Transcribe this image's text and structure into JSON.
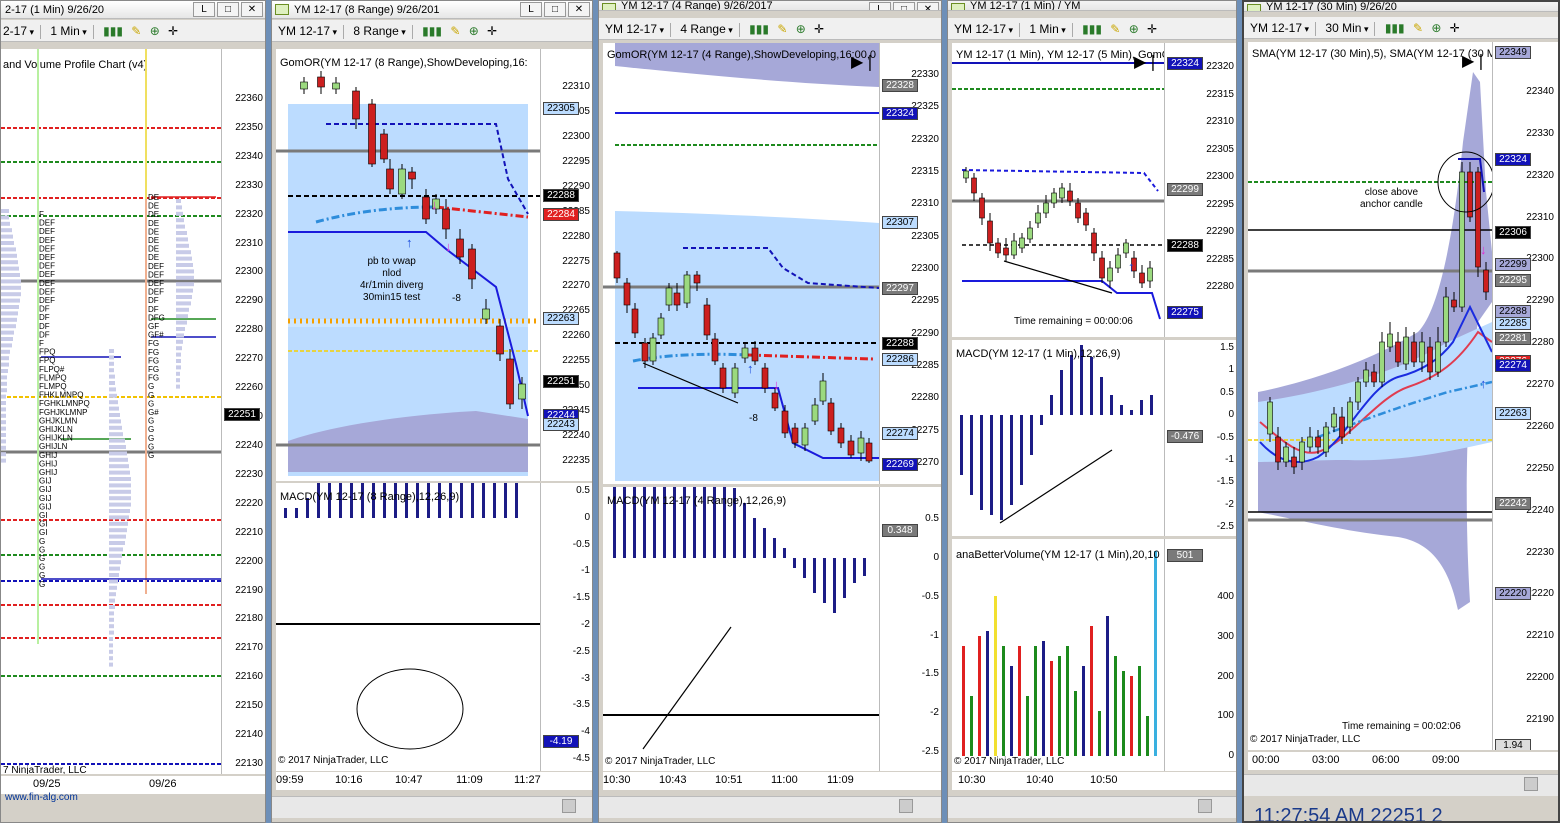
{
  "colors": {
    "up": "#9bd97f",
    "down": "#cc1f1f",
    "macd": "#1c1c86",
    "band": "#bcdcff",
    "cloud": "#a6a8d8",
    "vwap": "#2e8ddb",
    "red": "#e02020",
    "green": "#1f8a1f",
    "gray": "#7a7a7a",
    "navy": "#1212b8"
  },
  "win1": {
    "title": "2-17 (1 Min)  9/26/20",
    "instrument": "2-17",
    "period": "1 Min",
    "indicator": "and Volume Profile Chart (v4)",
    "price_labels": [
      "22360",
      "22350",
      "22340",
      "22330",
      "22320",
      "22310",
      "22300",
      "22290",
      "22280",
      "22270",
      "22260",
      "22250",
      "22240",
      "22230",
      "22220",
      "22210",
      "22200",
      "22190",
      "22180",
      "22170",
      "22160",
      "22150",
      "22140",
      "22130"
    ],
    "price_tag": "22251",
    "dates": [
      "09/25",
      "09/26"
    ],
    "copyright": "7 NinjaTrader, LLC",
    "website": "www.fin-alg.com",
    "profile1": [
      "F",
      "DEF",
      "DEF",
      "DEF",
      "DEF",
      "DEF",
      "DEF",
      "DEF",
      "DEF",
      "DEF",
      "DEF",
      "DF",
      "DF",
      "DF",
      "DF",
      "F",
      "FPQ",
      "FPQ",
      "FLPQ#",
      "FLMPQ",
      "FLMPQ",
      "FHKLMNPQ",
      "FGHKLMNPQ",
      "FGHJKLMNP",
      "GHJKLMN",
      "GHIJKLN",
      "GHIJKLN",
      "GHIJLN",
      "GHIJ",
      "GHIJ",
      "GHIJ",
      "GIJ",
      "GIJ",
      "GIJ",
      "GIJ",
      "GI",
      "GI",
      "GI",
      "G",
      "G",
      "G",
      "G",
      "G",
      "G"
    ],
    "profile2": [
      "DE",
      "DE",
      "DE",
      "DE",
      "DE",
      "DE",
      "DE",
      "DE",
      "DEF",
      "DEF",
      "DEF",
      "DEF",
      "DF",
      "DF",
      "DFG",
      "GF",
      "GF#",
      "FG",
      "FG",
      "FG",
      "FG",
      "FG",
      "G",
      "G",
      "G",
      "G#",
      "G",
      "G",
      "G",
      "G",
      "G"
    ]
  },
  "win2": {
    "title": "YM 12-17 (8 Range)  9/26/201",
    "instrument": "YM 12-17",
    "period": "8 Range",
    "indicator": "GomOR(YM 12-17 (8 Range),ShowDeveloping,16:",
    "price_labels": [
      "22310",
      "22305",
      "22300",
      "22295",
      "22290",
      "22285",
      "22280",
      "22275",
      "22270",
      "22265",
      "22260",
      "22255",
      "22250",
      "22245",
      "22240",
      "22235"
    ],
    "tags": [
      {
        "v": "22305",
        "c": "band"
      },
      {
        "v": "22288",
        "c": "black"
      },
      {
        "v": "22284",
        "c": "red"
      },
      {
        "v": "22263",
        "c": "band"
      },
      {
        "v": "22251",
        "c": "black"
      },
      {
        "v": "22244",
        "c": "navy"
      },
      {
        "v": "22243",
        "c": "band"
      }
    ],
    "annotation": [
      "pb to vwap",
      "nlod",
      "4r/1min diverg",
      "30min15 test"
    ],
    "minus8": "-8",
    "macd_title": "MACD(YM 12-17 (8 Range),12,26,9)",
    "macd_labels": [
      "0.5",
      "0",
      "-0.5",
      "-1",
      "-1.5",
      "-2",
      "-2.5",
      "-3",
      "-3.5",
      "-4",
      "-4.5"
    ],
    "macd_tag": "-4.19",
    "times": [
      "09:59",
      "10:16",
      "10:47",
      "11:09",
      "11:27"
    ],
    "copyright": "© 2017 NinjaTrader, LLC",
    "f": "F"
  },
  "win3": {
    "title": "YM 12-17 (4 Range)  9/26/2017",
    "instrument": "YM 12-17",
    "period": "4 Range",
    "indicator": "GomOR(YM 12-17 (4 Range),ShowDeveloping,16:00,0",
    "price_labels": [
      "22330",
      "22325",
      "22320",
      "22315",
      "22310",
      "22305",
      "22300",
      "22295",
      "22290",
      "22285",
      "22280",
      "22275",
      "22270"
    ],
    "tags": [
      {
        "v": "22328",
        "c": "gray"
      },
      {
        "v": "22324",
        "c": "navy"
      },
      {
        "v": "22307",
        "c": "band"
      },
      {
        "v": "22297",
        "c": "gray"
      },
      {
        "v": "22288",
        "c": "black"
      },
      {
        "v": "22286",
        "c": "band"
      },
      {
        "v": "22274",
        "c": "band"
      },
      {
        "v": "22269",
        "c": "navy"
      }
    ],
    "minus8": "-8",
    "macd_title": "MACD(YM 12-17 (4 Range),12,26,9)",
    "macd_labels": [
      "0.5",
      "0",
      "-0.5",
      "-1",
      "-1.5",
      "-2",
      "-2.5"
    ],
    "macd_tag": "0.348",
    "times": [
      "10:30",
      "10:43",
      "10:51",
      "11:00",
      "11:09"
    ],
    "copyright": "© 2017 NinjaTrader, LLC",
    "f": "F"
  },
  "win4": {
    "title": "YM 12-17 (1 Min) / YM",
    "instrument": "YM 12-17",
    "period": "1 Min",
    "indicator": "YM 12-17 (1 Min), YM 12-17 (5 Min), GomO",
    "price_labels": [
      "22320",
      "22315",
      "22310",
      "22305",
      "22300",
      "22295",
      "22290",
      "22285",
      "22280"
    ],
    "tags": [
      {
        "v": "22324",
        "c": "navy"
      },
      {
        "v": "22299",
        "c": "gray"
      },
      {
        "v": "22288",
        "c": "black"
      },
      {
        "v": "22275",
        "c": "navy"
      }
    ],
    "time_remaining": "Time remaining = 00:00:06",
    "macd_title": "MACD(YM 12-17 (1 Min),12,26,9)",
    "macd_labels": [
      "1.5",
      "1",
      "0.5",
      "0",
      "-0.5",
      "-1",
      "-1.5",
      "-2",
      "-2.5"
    ],
    "macd_tag": "-0.476",
    "vol_title": "anaBetterVolume(YM 12-17 (1 Min),20,10",
    "vol_labels": [
      "400",
      "300",
      "200",
      "100",
      "0"
    ],
    "vol_tag": "501",
    "times": [
      "10:30",
      "10:40",
      "10:50"
    ],
    "copyright": "© 2017 NinjaTrader, LLC"
  },
  "win5": {
    "title": "YM 12-17 (30 Min)  9/26/20",
    "instrument": "YM 12-17",
    "period": "30 Min",
    "indicator": "SMA(YM 12-17 (30 Min),5), SMA(YM 12-17 (30 M",
    "price_labels": [
      "22340",
      "22330",
      "22320",
      "22310",
      "22300",
      "22290",
      "22280",
      "22270",
      "22260",
      "22250",
      "22240",
      "22230",
      "22220",
      "22210",
      "22200",
      "22190"
    ],
    "tags": [
      {
        "v": "22349",
        "c": "cloud"
      },
      {
        "v": "22324",
        "c": "navy"
      },
      {
        "v": "22306",
        "c": "black"
      },
      {
        "v": "22299",
        "c": "cloud"
      },
      {
        "v": "22295",
        "c": "gray"
      },
      {
        "v": "22288",
        "c": "cloud"
      },
      {
        "v": "22285",
        "c": "band"
      },
      {
        "v": "22281",
        "c": "gray"
      },
      {
        "v": "22276",
        "c": "red"
      },
      {
        "v": "22274",
        "c": "navy"
      },
      {
        "v": "22263",
        "c": "band"
      },
      {
        "v": "22242",
        "c": "gray"
      },
      {
        "v": "22220",
        "c": "cloud"
      }
    ],
    "annotation": [
      "close above",
      "anchor candle"
    ],
    "time_remaining": "Time remaining = 00:02:06",
    "small_tag": "1.94",
    "times": [
      "00:00",
      "03:00",
      "06:00",
      "09:00"
    ],
    "copyright": "© 2017 NinjaTrader, LLC",
    "status": "11:27:54 AM   22251        2"
  }
}
